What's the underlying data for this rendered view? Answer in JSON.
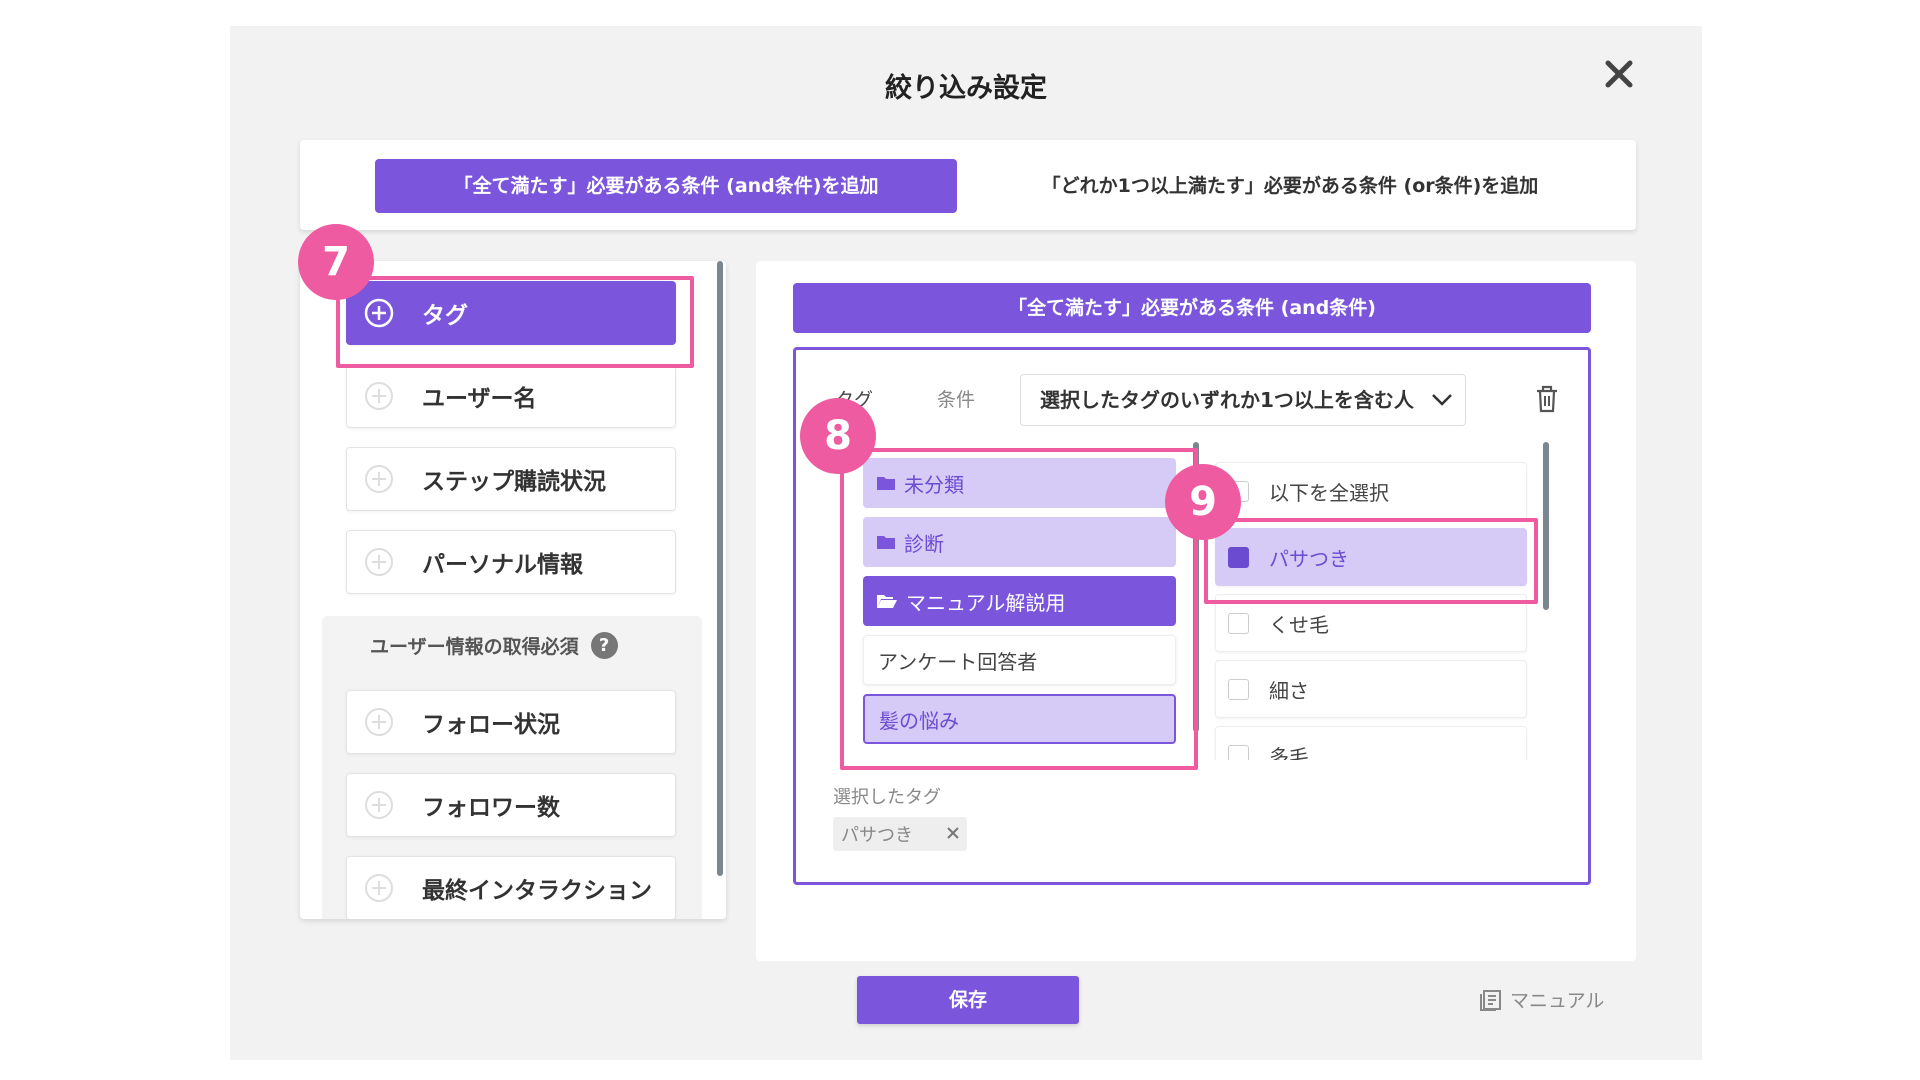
{
  "dialog": {
    "title": "絞り込み設定"
  },
  "mode_tabs": {
    "and_label": "「全て満たす」必要がある条件 (and条件)を追加",
    "or_label": "「どれか1つ以上満たす」必要がある条件 (or条件)を追加"
  },
  "categories": {
    "tag": "タグ",
    "username": "ユーザー名",
    "step": "ステップ購読状況",
    "personal": "パーソナル情報",
    "section_title": "ユーザー情報の取得必須",
    "help": "?",
    "follow": "フォロー状況",
    "followers": "フォロワー数",
    "last_interaction": "最終インタラクション"
  },
  "condition": {
    "header": "「全て満たす」必要がある条件 (and条件)",
    "tag_label": "タグ",
    "cond_label": "条件",
    "select_value": "選択したタグのいずれか1つ以上を含む人",
    "tag_items": [
      {
        "label": "未分類",
        "state": "folder"
      },
      {
        "label": "診断",
        "state": "folder"
      },
      {
        "label": "マニュアル解説用",
        "state": "open"
      },
      {
        "label": "アンケート回答者",
        "state": "plain"
      },
      {
        "label": "髪の悩み",
        "state": "highlight"
      }
    ],
    "checks": [
      {
        "label": "以下を全選択",
        "checked": false
      },
      {
        "label": "パサつき",
        "checked": true
      },
      {
        "label": "くせ毛",
        "checked": false
      },
      {
        "label": "細さ",
        "checked": false
      },
      {
        "label": "多毛",
        "checked": false
      }
    ],
    "selected_label": "選択したタグ",
    "selected_chip": "パサつき"
  },
  "footer": {
    "save": "保存",
    "manual": "マニュアル"
  },
  "annotations": {
    "step7": "7",
    "step8": "8",
    "step9": "9"
  },
  "colors": {
    "accent": "#7b56dc",
    "accent_light": "#d6cbf7",
    "annotation": "#ef5ba1"
  }
}
